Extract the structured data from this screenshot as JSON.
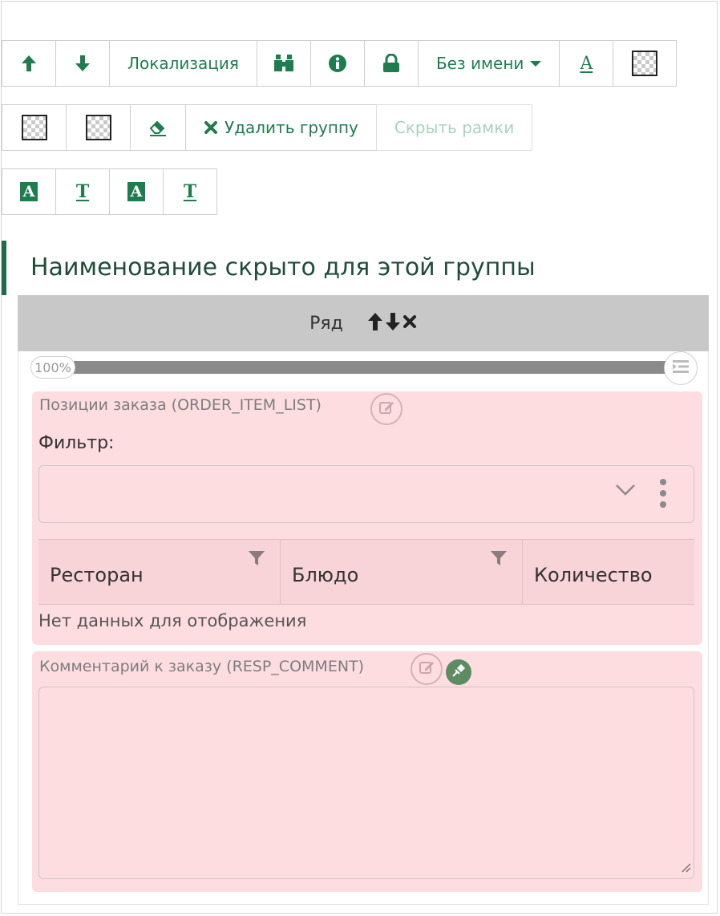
{
  "toolbar_row1": {
    "up_icon": "arrow-up-icon",
    "down_icon": "arrow-down-icon",
    "localization_label": "Локализация",
    "search_icon": "binoculars-icon",
    "info_icon": "info-circle-icon",
    "lock_icon": "lock-icon",
    "name_dropdown_label": "Без имени",
    "font_color_letter": "A",
    "background_icon": "transparent-checker-icon"
  },
  "toolbar_row2": {
    "checker1_icon": "transparent-checker-icon",
    "checker2_icon": "transparent-checker-icon",
    "eraser_icon": "eraser-icon",
    "delete_group_label": "Удалить группу",
    "hide_borders_label": "Скрыть рамки"
  },
  "toolbar_row3": {
    "btn1_letter": "A",
    "btn2_letter": "T",
    "btn3_letter": "A",
    "btn4_letter": "T"
  },
  "group": {
    "title": "Наименование скрыто для этой группы"
  },
  "row": {
    "label": "Ряд",
    "width_percent_label": "100%",
    "width_fraction": 1.0
  },
  "order_items_field": {
    "caption": "Позиции заказа (ORDER_ITEM_LIST)",
    "filter_label": "Фильтр:",
    "filter_value": "",
    "columns": [
      "Ресторан",
      "Блюдо",
      "Количество"
    ],
    "empty_text": "Нет данных для отображения"
  },
  "comment_field": {
    "caption": "Комментарий к заказу (RESP_COMMENT)",
    "value": ""
  },
  "colors": {
    "accent_green": "#1e7d4f",
    "field_background": "#fddde0",
    "row_header": "#c8c8c8"
  }
}
